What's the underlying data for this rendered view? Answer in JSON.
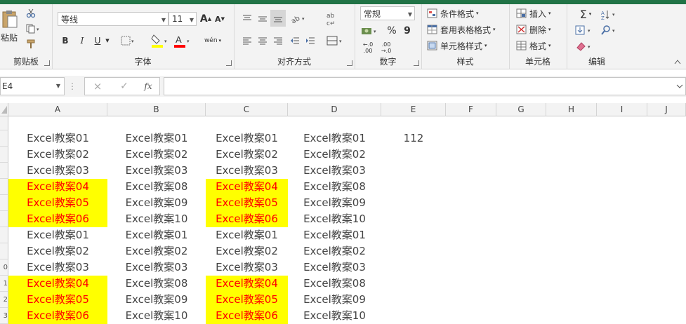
{
  "ribbon": {
    "clipboard": {
      "group_label": "剪贴板",
      "paste_label": "粘贴"
    },
    "font": {
      "group_label": "字体",
      "font_name": "等线",
      "font_size": "11",
      "bold": "B",
      "italic": "I",
      "underline": "U",
      "grow": "A",
      "shrink": "A",
      "phonetic": "wén",
      "font_color": "#ff0000",
      "fill_color": "#ffff00"
    },
    "alignment": {
      "group_label": "对齐方式"
    },
    "number": {
      "group_label": "数字",
      "format": "常规",
      "percent": "%",
      "comma": "9",
      "inc_decimal_top": "←.0",
      "inc_decimal_bottom": ".00",
      "dec_decimal_top": ".00",
      "dec_decimal_bottom": "→.0"
    },
    "styles": {
      "group_label": "样式",
      "conditional": "条件格式",
      "table": "套用表格格式",
      "cell": "单元格样式"
    },
    "cells": {
      "group_label": "单元格",
      "insert": "插入",
      "delete": "删除",
      "format": "格式"
    },
    "editing": {
      "group_label": "编辑",
      "sum": "Σ"
    }
  },
  "formula_bar": {
    "name_box": "E4",
    "fx": "fx",
    "cancel": "×",
    "enter": "✓",
    "content": ""
  },
  "columns": [
    "A",
    "B",
    "C",
    "D",
    "E",
    "F",
    "G",
    "H",
    "I",
    "J"
  ],
  "rows": [
    "",
    "",
    "",
    "",
    "",
    "",
    "",
    "",
    "0",
    "1",
    "2",
    "3"
  ],
  "cells": {
    "A": [
      "Excel教案01",
      "Excel教案02",
      "Excel教案03",
      "Excel教案04",
      "Excel教案05",
      "Excel教案06",
      "Excel教案01",
      "Excel教案02",
      "Excel教案03",
      "Excel教案04",
      "Excel教案05",
      "Excel教案06"
    ],
    "B": [
      "Excel教案01",
      "Excel教案02",
      "Excel教案03",
      "Excel教案08",
      "Excel教案09",
      "Excel教案10",
      "Excel教案01",
      "Excel教案02",
      "Excel教案03",
      "Excel教案08",
      "Excel教案09",
      "Excel教案10"
    ],
    "C": [
      "Excel教案01",
      "Excel教案02",
      "Excel教案03",
      "Excel教案04",
      "Excel教案05",
      "Excel教案06",
      "Excel教案01",
      "Excel教案02",
      "Excel教案03",
      "Excel教案04",
      "Excel教案05",
      "Excel教案06"
    ],
    "D": [
      "Excel教案01",
      "Excel教案02",
      "Excel教案03",
      "Excel教案08",
      "Excel教案09",
      "Excel教案10",
      "Excel教案01",
      "Excel教案02",
      "Excel教案03",
      "Excel教案08",
      "Excel教案09",
      "Excel教案10"
    ],
    "E1": "112"
  },
  "highlight": {
    "fill": "#ffff00",
    "text": "#ff0000",
    "rows": [
      3,
      4,
      5,
      9,
      10,
      11
    ],
    "columns": [
      "A",
      "C"
    ]
  }
}
